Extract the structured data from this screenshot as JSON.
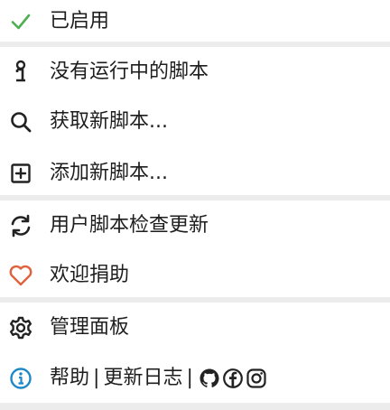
{
  "menu": {
    "enabled": {
      "label": "已启用",
      "icon": "check-icon",
      "color": "#4caf50"
    },
    "no_scripts": {
      "label": "没有运行中的脚本",
      "icon": "info-i-icon"
    },
    "get_scripts": {
      "label": "获取新脚本...",
      "icon": "search-icon"
    },
    "add_script": {
      "label": "添加新脚本...",
      "icon": "plus-square-icon"
    },
    "check_updates": {
      "label": "用户脚本检查更新",
      "icon": "sync-icon"
    },
    "donate": {
      "label": "欢迎捐助",
      "icon": "heart-icon",
      "color": "#e0623d"
    },
    "dashboard": {
      "label": "管理面板",
      "icon": "gear-icon"
    },
    "help": {
      "icon": "info-circle-icon",
      "color": "#1e88c7",
      "help_label": "帮助",
      "separator": "|",
      "changelog_label": "更新日志",
      "social_icons": [
        "github-icon",
        "facebook-icon",
        "instagram-icon"
      ]
    }
  }
}
